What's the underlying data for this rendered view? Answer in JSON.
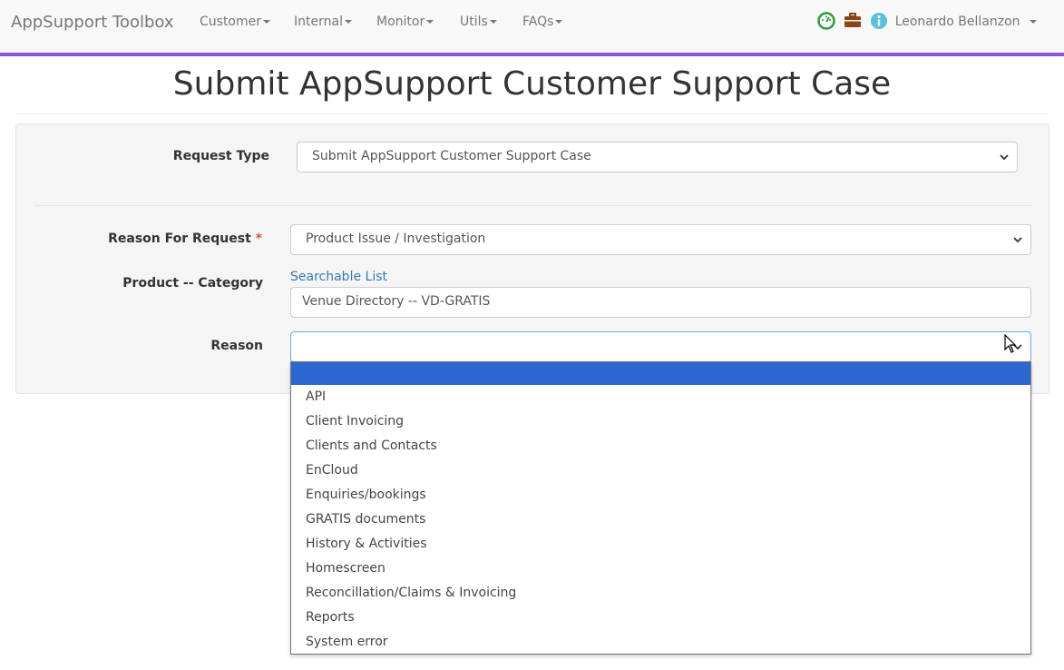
{
  "navbar": {
    "brand": "AppSupport Toolbox",
    "menus": [
      "Customer",
      "Internal",
      "Monitor",
      "Utils",
      "FAQs"
    ],
    "icons": [
      "dashboard-icon",
      "briefcase-icon",
      "info-icon"
    ],
    "user": "Leonardo Bellanzon",
    "accent_color": "#8a56d1"
  },
  "page": {
    "title": "Submit AppSupport Customer Support Case"
  },
  "form": {
    "request_type_label": "Request Type",
    "request_type_value": "Submit AppSupport Customer Support Case",
    "reason_for_request_label": "Reason For Request",
    "required_mark": "*",
    "reason_for_request_value": "Product Issue / Investigation",
    "product_category_label": "Product -- Category",
    "searchable_list_link": "Searchable List",
    "product_category_value": "Venue Directory -- VD-GRATIS",
    "reason_label": "Reason",
    "reason_value": ""
  },
  "reason_dropdown": {
    "selected_index": 0,
    "options": [
      "",
      "API",
      "Client Invoicing",
      "Clients and Contacts",
      "EnCloud",
      "Enquiries/bookings",
      "GRATIS documents",
      "History & Activities",
      "Homescreen",
      "Reconcillation/Claims & Invoicing",
      "Reports",
      "System error"
    ],
    "highlight_color": "#2c66d1"
  }
}
